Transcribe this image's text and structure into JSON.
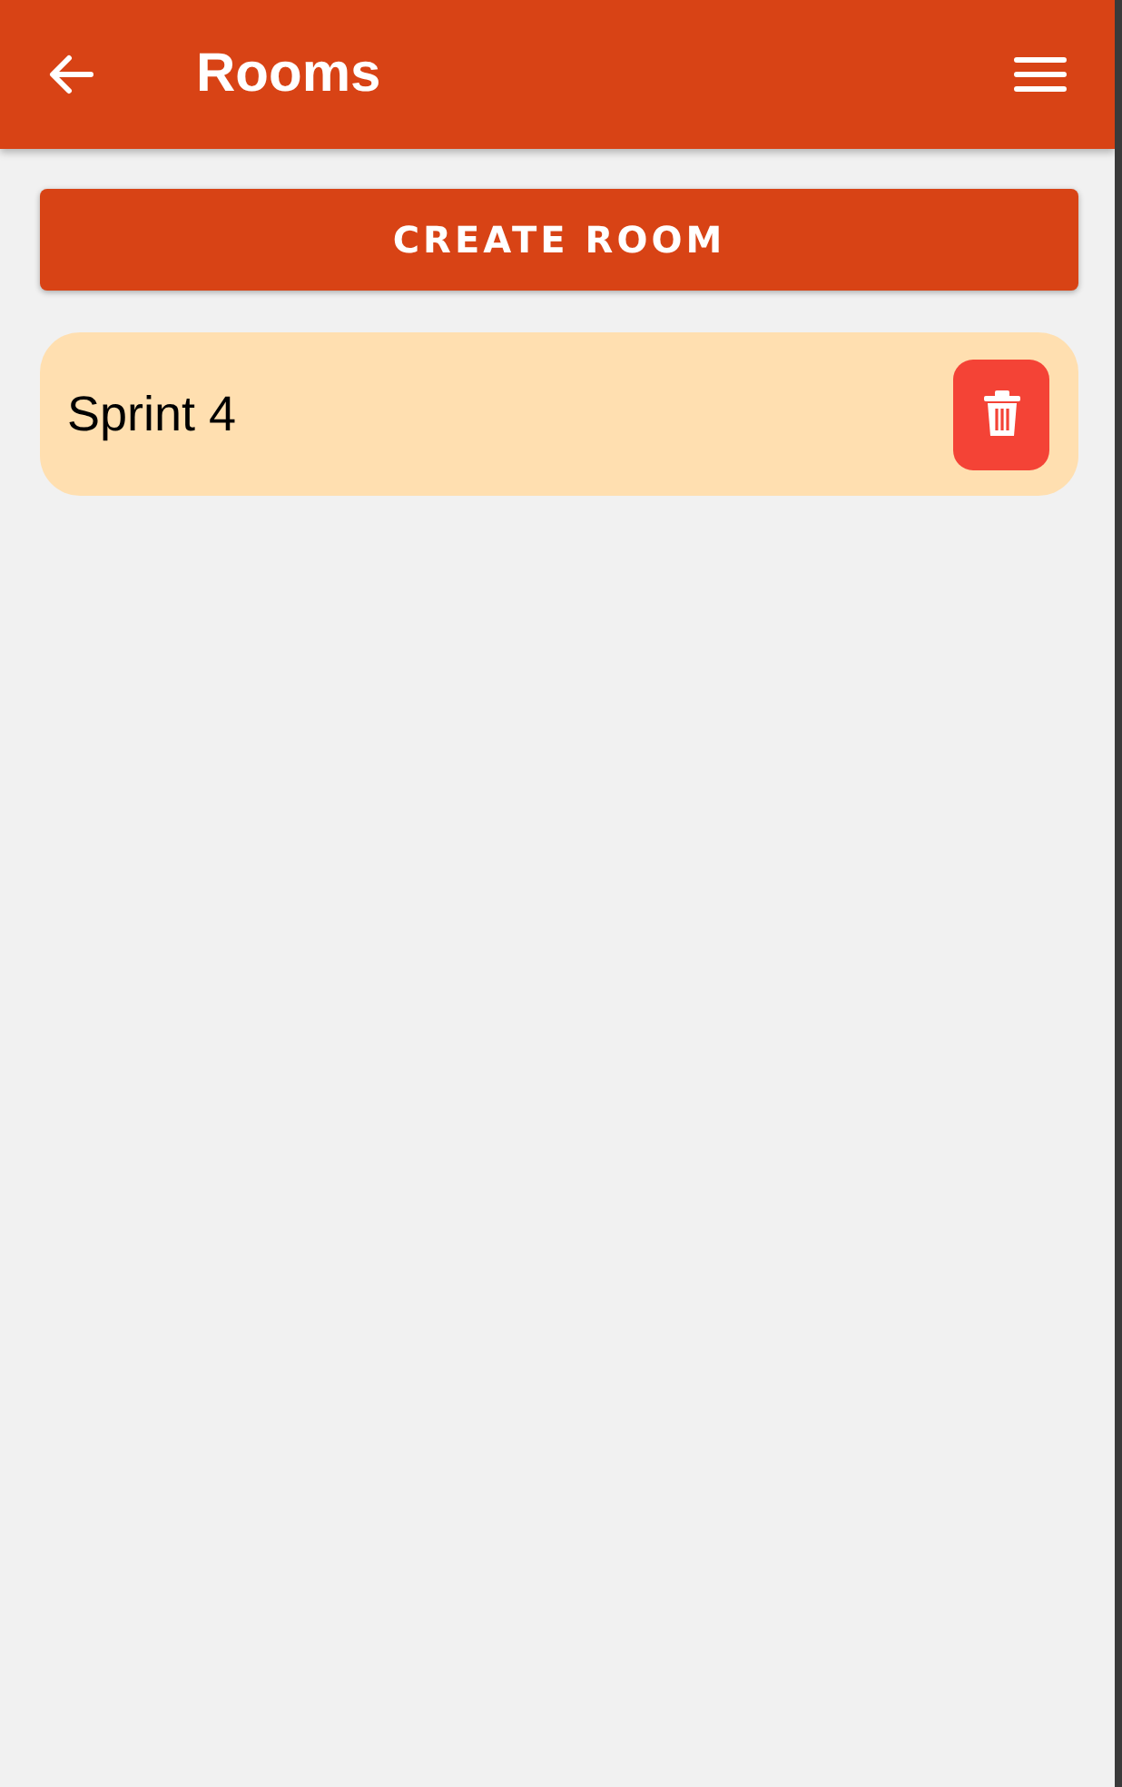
{
  "header": {
    "title": "Rooms"
  },
  "create_button": {
    "label": "CREATE ROOM"
  },
  "rooms": [
    {
      "name": "Sprint 4"
    }
  ]
}
